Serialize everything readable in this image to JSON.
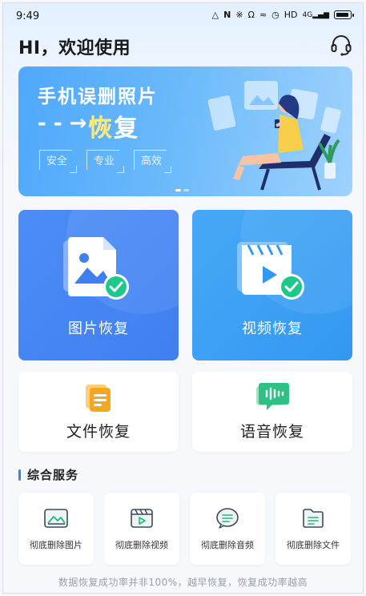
{
  "status_bar": {
    "time": "9:49",
    "icons": [
      "signal-drop-icon",
      "nfc-icon",
      "bluetooth-icon",
      "headphone-icon",
      "vibrate-icon",
      "alarm-icon",
      "hd-icon",
      "mobile-signal-icon",
      "battery-icon"
    ],
    "hd_label": "HD",
    "network_label": "4G"
  },
  "header": {
    "greeting": "HI，欢迎使用",
    "support_icon": "headset-icon"
  },
  "banner": {
    "title": "手机误删照片",
    "arrow": "- - →",
    "subtitle_a": "恢",
    "subtitle_b": "复",
    "tags": [
      "安全",
      "专业",
      "高效"
    ],
    "active_slide": 1,
    "slide_count": 2
  },
  "main_cards": [
    {
      "label": "图片恢复",
      "icon": "image-recovery-icon"
    },
    {
      "label": "视频恢复",
      "icon": "video-recovery-icon"
    }
  ],
  "secondary_cards": [
    {
      "label": "文件恢复",
      "icon": "document-icon"
    },
    {
      "label": "语音恢复",
      "icon": "voice-message-icon"
    }
  ],
  "services": {
    "title": "综合服务",
    "items": [
      {
        "label": "彻底删除图片",
        "icon": "image-delete-icon"
      },
      {
        "label": "彻底删除视频",
        "icon": "video-delete-icon"
      },
      {
        "label": "彻底删除音频",
        "icon": "audio-delete-icon"
      },
      {
        "label": "彻底删除文件",
        "icon": "file-delete-icon"
      }
    ]
  },
  "footer": {
    "note": "数据恢复成功率并非100%，越早恢复，恢复成功率越高"
  },
  "colors": {
    "primary": "#3f7ff1",
    "video_card": "#3398f1",
    "check": "#1dc98a",
    "doc_orange": "#f6a623",
    "voice_green": "#2fc184"
  }
}
